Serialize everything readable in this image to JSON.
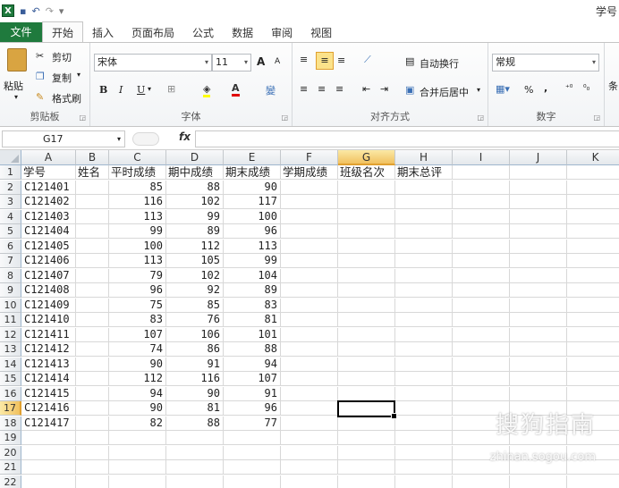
{
  "window": {
    "title_fragment": "学号"
  },
  "quick_access": {
    "save_icon": "save-icon",
    "undo_icon": "undo-icon",
    "redo_icon": "redo-icon"
  },
  "tabs": [
    {
      "label": "文件"
    },
    {
      "label": "开始"
    },
    {
      "label": "插入"
    },
    {
      "label": "页面布局"
    },
    {
      "label": "公式"
    },
    {
      "label": "数据"
    },
    {
      "label": "审阅"
    },
    {
      "label": "视图"
    }
  ],
  "ribbon": {
    "clipboard": {
      "paste": "粘贴",
      "cut": "剪切",
      "copy": "复制",
      "format_painter": "格式刷",
      "group_label": "剪贴板"
    },
    "font": {
      "font_name": "宋体",
      "font_size": "11",
      "bold": "B",
      "italic": "I",
      "underline": "U",
      "group_label": "字体",
      "grow": "A",
      "shrink": "A",
      "color_letter": "A",
      "phonetic": "變"
    },
    "alignment": {
      "wrap_text": "自动换行",
      "merge_center": "合并后居中",
      "group_label": "对齐方式"
    },
    "number": {
      "format": "常规",
      "percent": "%",
      "comma": ",",
      "group_label": "数字"
    },
    "styles": {
      "conditional_fragment": "条"
    }
  },
  "formula_bar": {
    "name_box": "G17",
    "fx": "fx",
    "formula": ""
  },
  "columns": [
    "A",
    "B",
    "C",
    "D",
    "E",
    "F",
    "G",
    "H",
    "I",
    "J",
    "K"
  ],
  "rows": [
    "1",
    "2",
    "3",
    "4",
    "5",
    "6",
    "7",
    "8",
    "9",
    "10",
    "11",
    "12",
    "13",
    "14",
    "15",
    "16",
    "17",
    "18",
    "19",
    "20",
    "21",
    "22"
  ],
  "header_row": [
    "学号",
    "姓名",
    "平时成绩",
    "期中成绩",
    "期末成绩",
    "学期成绩",
    "班级名次",
    "期末总评"
  ],
  "data_rows": [
    [
      "C121401",
      "",
      "85",
      "88",
      "90"
    ],
    [
      "C121402",
      "",
      "116",
      "102",
      "117"
    ],
    [
      "C121403",
      "",
      "113",
      "99",
      "100"
    ],
    [
      "C121404",
      "",
      "99",
      "89",
      "96"
    ],
    [
      "C121405",
      "",
      "100",
      "112",
      "113"
    ],
    [
      "C121406",
      "",
      "113",
      "105",
      "99"
    ],
    [
      "C121407",
      "",
      "79",
      "102",
      "104"
    ],
    [
      "C121408",
      "",
      "96",
      "92",
      "89"
    ],
    [
      "C121409",
      "",
      "75",
      "85",
      "83"
    ],
    [
      "C121410",
      "",
      "83",
      "76",
      "81"
    ],
    [
      "C121411",
      "",
      "107",
      "106",
      "101"
    ],
    [
      "C121412",
      "",
      "74",
      "86",
      "88"
    ],
    [
      "C121413",
      "",
      "90",
      "91",
      "94"
    ],
    [
      "C121414",
      "",
      "112",
      "116",
      "107"
    ],
    [
      "C121415",
      "",
      "94",
      "90",
      "91"
    ],
    [
      "C121416",
      "",
      "90",
      "81",
      "96"
    ],
    [
      "C121417",
      "",
      "82",
      "88",
      "77"
    ]
  ],
  "selection": {
    "column": "G",
    "row": "17"
  },
  "watermark": {
    "brand": "搜狗指南",
    "url": "zhinan.sogou.com"
  },
  "colors": {
    "excel_green": "#1f7a3d",
    "selection_header": "#f1c15f"
  }
}
